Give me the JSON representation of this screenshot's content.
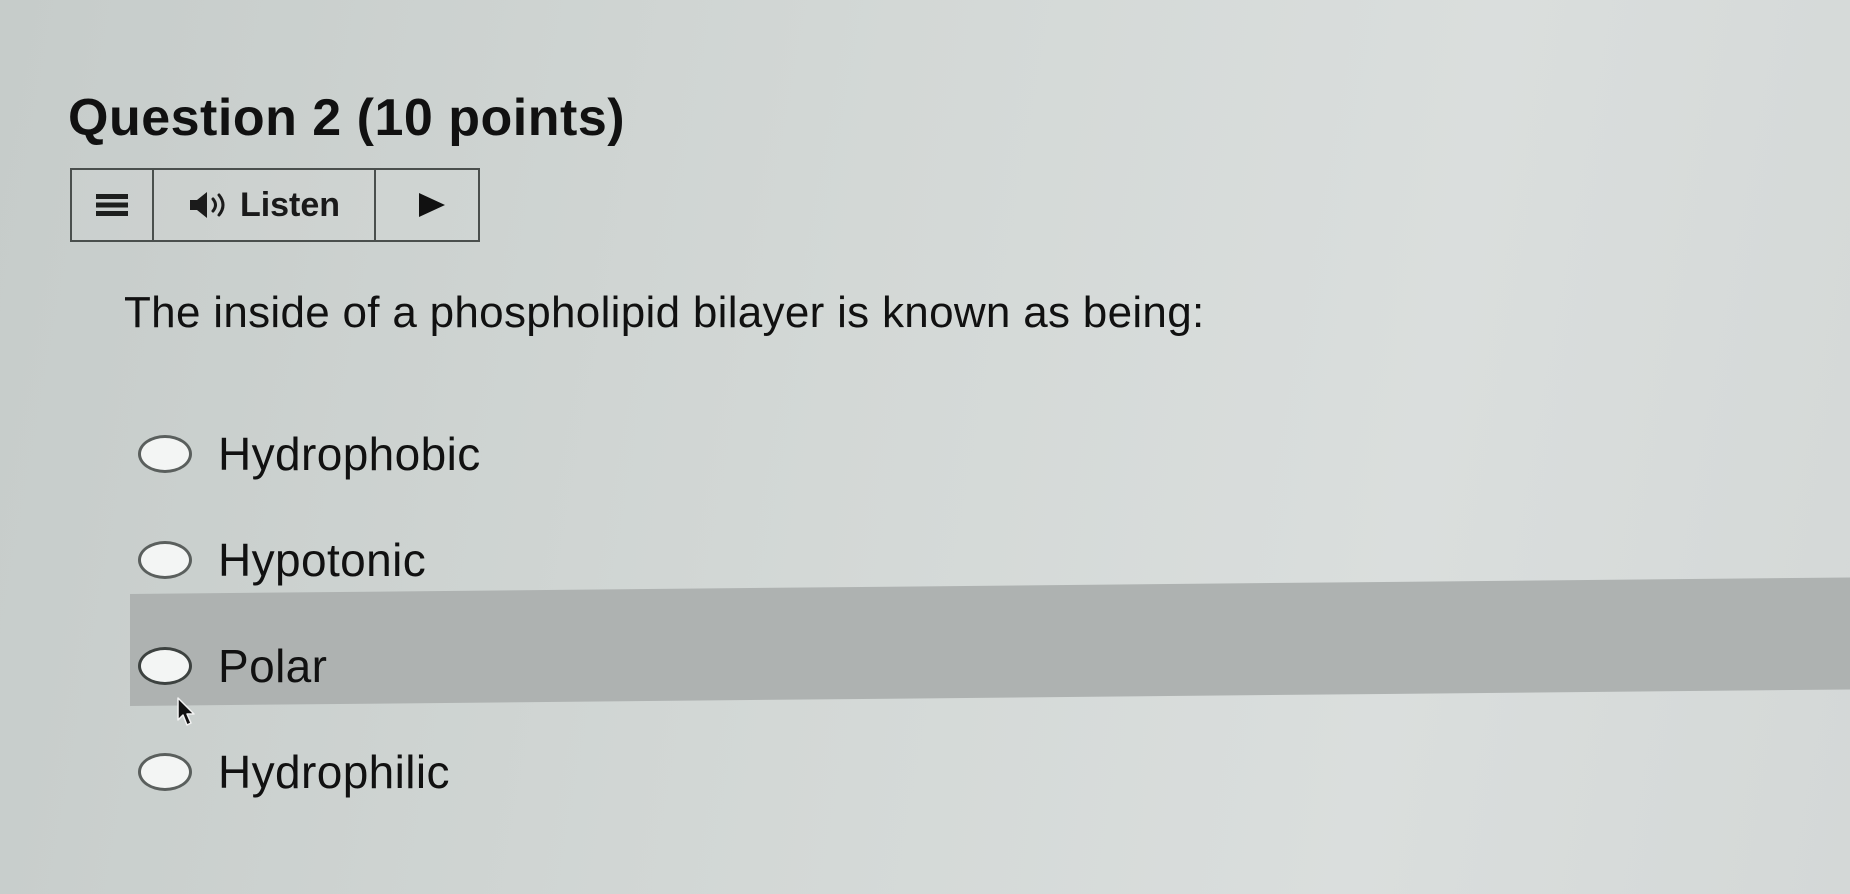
{
  "question": {
    "title": "Question 2 (10 points)",
    "prompt": "The inside of a phospholipid bilayer is known as being:"
  },
  "listen_bar": {
    "menu_icon": "hamburger-menu-icon",
    "speaker_icon": "speaker-icon",
    "listen_label": "Listen",
    "play_icon": "play-icon"
  },
  "options": [
    {
      "label": "Hydrophobic",
      "selected": false
    },
    {
      "label": "Hypotonic",
      "selected": false
    },
    {
      "label": "Polar",
      "selected": false,
      "hovered": true
    },
    {
      "label": "Hydrophilic",
      "selected": false
    }
  ],
  "colors": {
    "background": "#d3d8d6",
    "hover_band": "#aeb2b1",
    "text": "#111111"
  }
}
